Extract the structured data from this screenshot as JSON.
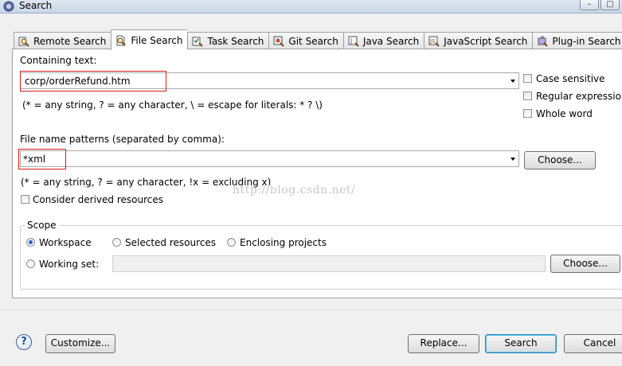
{
  "window": {
    "title": "Search"
  },
  "tabs": [
    {
      "label": "Remote Search",
      "icon": "remote-search-icon",
      "active": false
    },
    {
      "label": "File Search",
      "icon": "file-search-icon",
      "active": true
    },
    {
      "label": "Task Search",
      "icon": "task-search-icon",
      "active": false
    },
    {
      "label": "Git Search",
      "icon": "git-search-icon",
      "active": false
    },
    {
      "label": "Java Search",
      "icon": "java-search-icon",
      "active": false
    },
    {
      "label": "JavaScript Search",
      "icon": "javascript-search-icon",
      "active": false
    },
    {
      "label": "Plug-in Search",
      "icon": "plugin-search-icon",
      "active": false
    }
  ],
  "containing": {
    "label": "Containing text:",
    "value": "corp/orderRefund.htm",
    "hint": "(* = any string, ? = any character, \\ = escape for literals: * ? \\)"
  },
  "options": {
    "case_sensitive": "Case sensitive",
    "regex": "Regular expression",
    "whole_word": "Whole word"
  },
  "patterns": {
    "label": "File name patterns (separated by comma):",
    "value": "*xml",
    "hint": "(* = any string, ? = any character, !x = excluding x)",
    "choose": "Choose..."
  },
  "derived": {
    "label": "Consider derived resources"
  },
  "watermark": "http://blog.csdn.net/",
  "scope": {
    "legend": "Scope",
    "workspace": "Workspace",
    "selected": "Selected resources",
    "enclosing": "Enclosing projects",
    "working_set": "Working set:",
    "choose": "Choose..."
  },
  "footer": {
    "customize": "Customize...",
    "replace": "Replace...",
    "search": "Search",
    "cancel": "Cancel"
  }
}
